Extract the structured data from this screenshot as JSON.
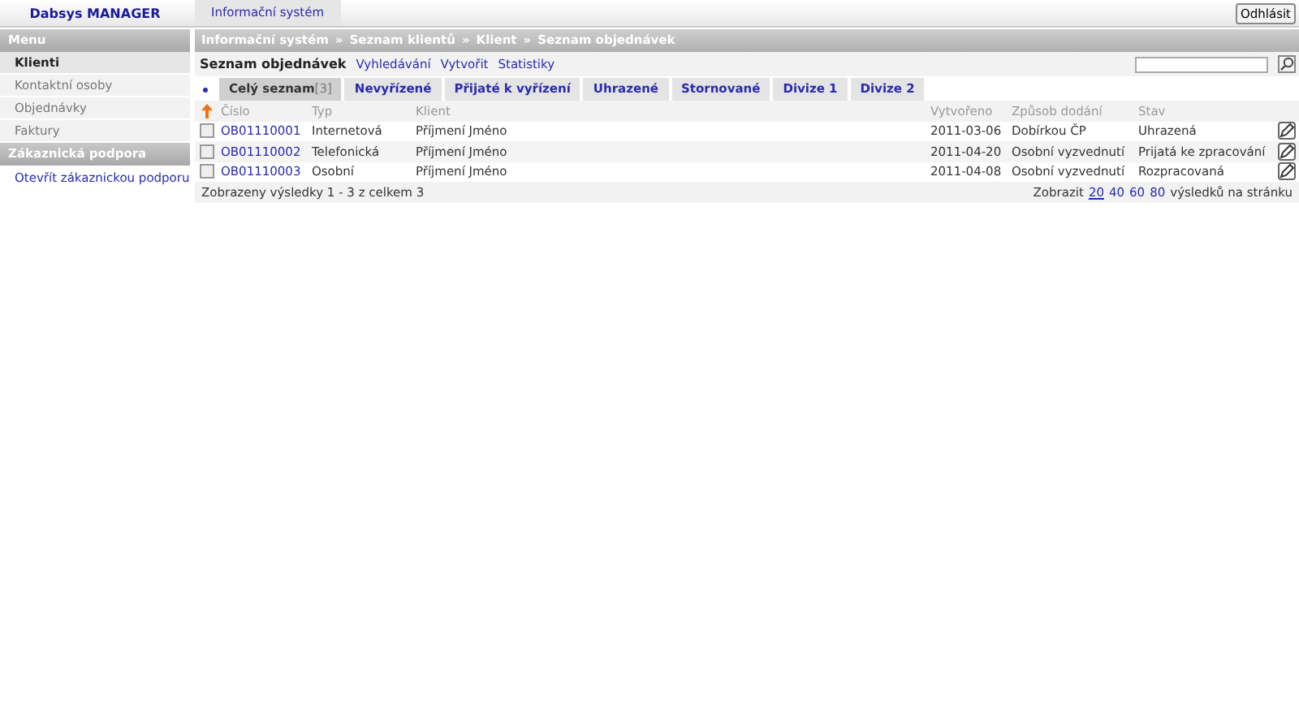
{
  "app": {
    "title": "Dabsys MANAGER"
  },
  "top_nav": [
    {
      "label": "Informační systém",
      "selected": true
    }
  ],
  "logout_button": "Odhlásit",
  "sidebar": {
    "sections": [
      {
        "title": "Menu",
        "items": [
          {
            "label": "Klienti",
            "selected": true
          },
          {
            "label": "Kontaktní osoby",
            "selected": false
          },
          {
            "label": "Objednávky",
            "selected": false
          },
          {
            "label": "Faktury",
            "selected": false
          }
        ]
      },
      {
        "title": "Zákaznická podpora",
        "items": [
          {
            "label": "Otevřít zákaznickou podporu",
            "selected": false,
            "link": true
          }
        ]
      }
    ]
  },
  "breadcrumb": [
    "Informační systém",
    "»",
    "Seznam klientů",
    "»",
    "Klient",
    "»",
    "Seznam objednávek"
  ],
  "page_title": "Seznam objednávek",
  "actions": [
    "Vyhledávání",
    "Vytvořit",
    "Statistiky"
  ],
  "tabs": [
    {
      "label": "Celý seznam",
      "count": "[3]",
      "selected": true
    },
    {
      "label": "Nevyřízené",
      "selected": false
    },
    {
      "label": "Přijaté k vyřízení",
      "selected": false
    },
    {
      "label": "Uhrazené",
      "selected": false
    },
    {
      "label": "Stornované",
      "selected": false
    },
    {
      "label": "Divize 1",
      "selected": false
    },
    {
      "label": "Divize 2",
      "selected": false
    }
  ],
  "table": {
    "columns": [
      "Číslo",
      "Typ",
      "Klient",
      "Vytvořeno",
      "Způsob dodání",
      "Stav"
    ],
    "rows": [
      {
        "checked": false,
        "cells": [
          "OB01110001",
          "Internetová",
          "Příjmení Jméno",
          "2011-03-06",
          "Dobírkou ČP",
          "Uhrazená"
        ]
      },
      {
        "checked": false,
        "cells": [
          "OB01110002",
          "Telefonická",
          "Příjmení Jméno",
          "2011-04-20",
          "Osobní vyzvednutí",
          "Prijatá ke zpracování"
        ]
      },
      {
        "checked": false,
        "cells": [
          "OB01110003",
          "Osobní",
          "Příjmení Jméno",
          "2011-04-08",
          "Osobní vyzvednutí",
          "Rozpracovaná"
        ]
      }
    ]
  },
  "footer": {
    "summary": "Zobrazeny výsledky 1 - 3 z celkem 3",
    "show_label": "Zobrazit",
    "page_sizes": [
      {
        "label": "20",
        "selected": true
      },
      {
        "label": "40",
        "selected": false
      },
      {
        "label": "60",
        "selected": false
      },
      {
        "label": "80",
        "selected": false
      }
    ],
    "suffix": "výsledků na stránku"
  }
}
